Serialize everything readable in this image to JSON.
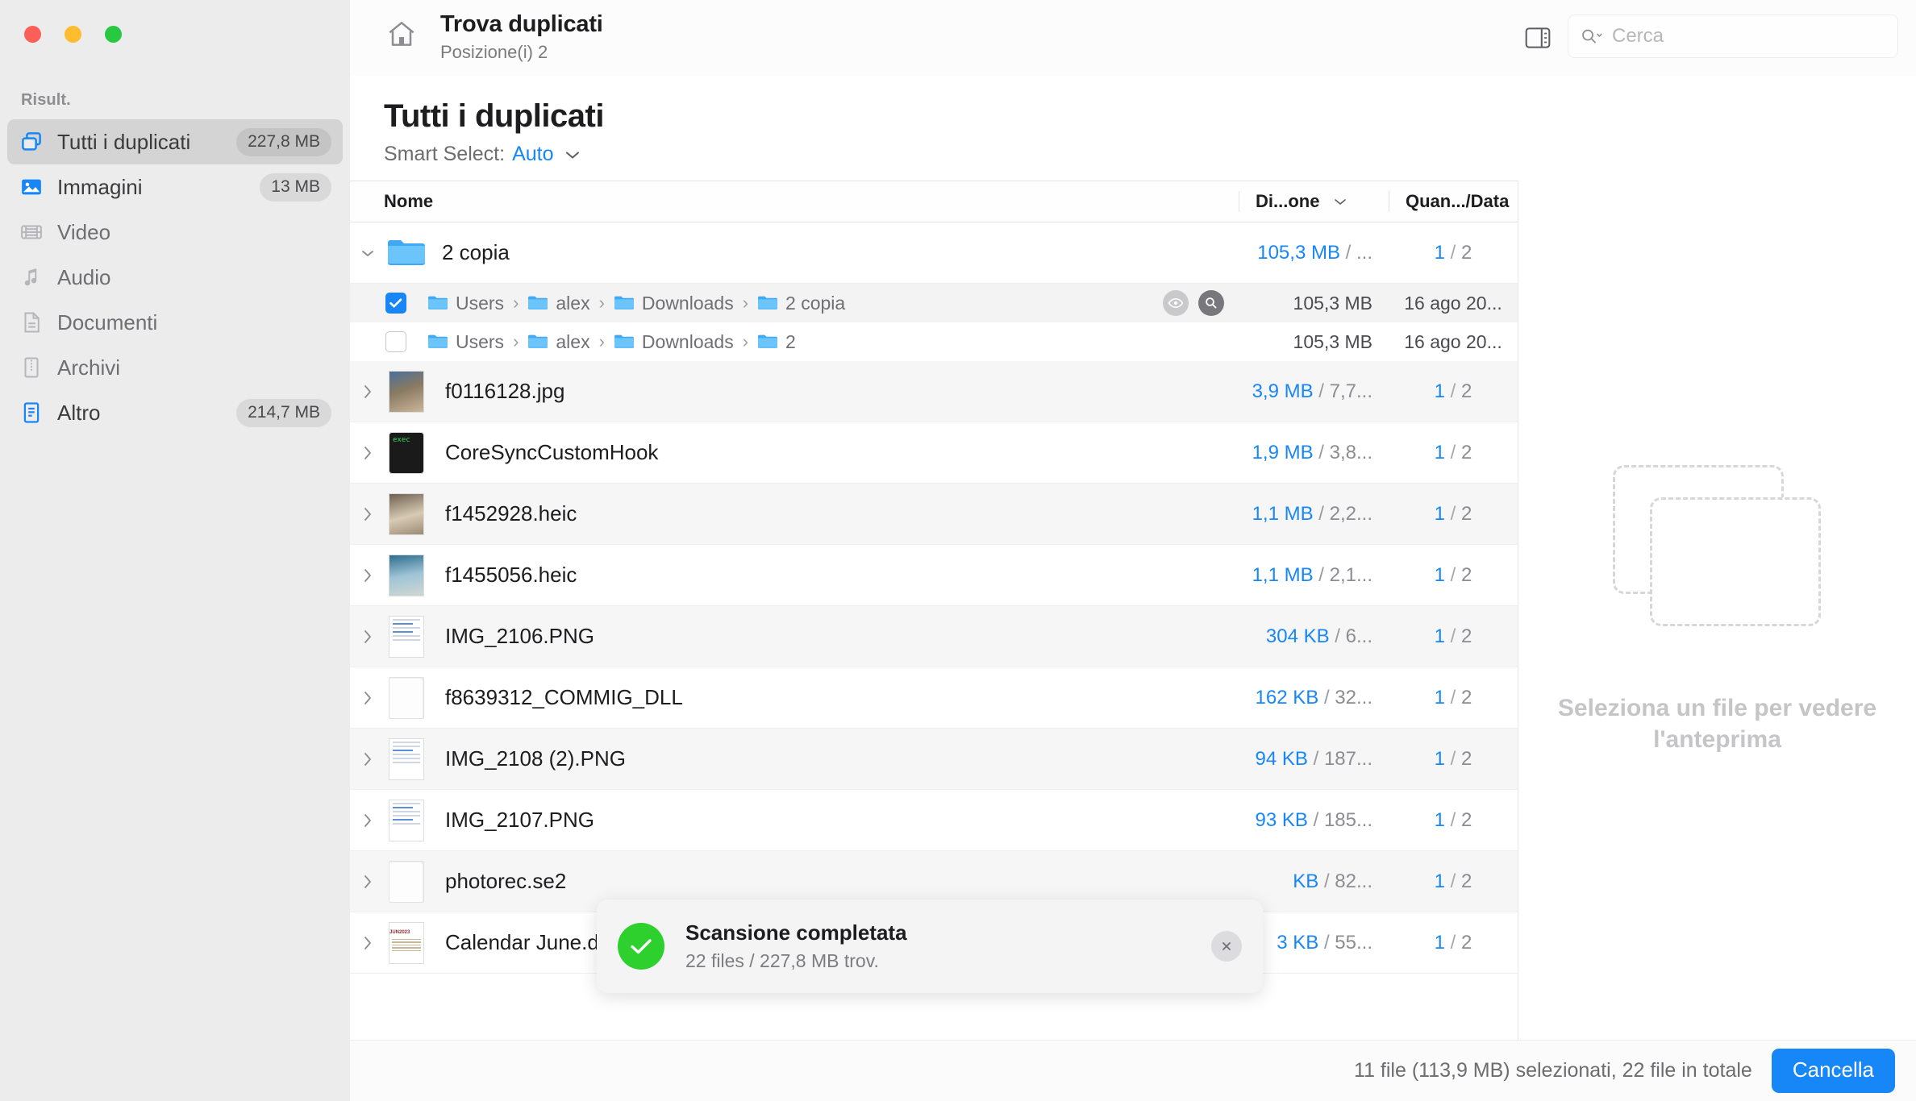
{
  "window": {
    "traffic_lights": [
      "close",
      "minimize",
      "zoom"
    ],
    "colors": {
      "accent": "#1787f8",
      "success": "#2ed02e",
      "sidebar_bg": "#ececec"
    }
  },
  "sidebar": {
    "section_title": "Risult.",
    "items": [
      {
        "label": "Tutti i duplicati",
        "badge": "227,8 MB",
        "icon": "duplicates-icon",
        "selected": true
      },
      {
        "label": "Immagini",
        "badge": "13 MB",
        "icon": "image-icon",
        "selected": false
      },
      {
        "label": "Video",
        "badge": "",
        "icon": "video-icon",
        "selected": false
      },
      {
        "label": "Audio",
        "badge": "",
        "icon": "audio-icon",
        "selected": false
      },
      {
        "label": "Documenti",
        "badge": "",
        "icon": "document-icon",
        "selected": false
      },
      {
        "label": "Archivi",
        "badge": "",
        "icon": "archive-icon",
        "selected": false
      },
      {
        "label": "Altro",
        "badge": "214,7 MB",
        "icon": "other-icon",
        "selected": false
      }
    ]
  },
  "topbar": {
    "home_icon": "home-icon",
    "title": "Trova duplicati",
    "subtitle": "Posizione(i) 2",
    "sidebar_toggle_icon": "sidebar-toggle-icon",
    "search": {
      "icon": "search-icon",
      "placeholder": "Cerca",
      "value": ""
    }
  },
  "page": {
    "title": "Tutti i duplicati",
    "smart_select_label": "Smart Select:",
    "smart_select_value": "Auto",
    "smart_select_chevron": "chevron-down-icon"
  },
  "table": {
    "columns": {
      "name": "Nome",
      "size": "Di...one",
      "size_sort_icon": "chevron-down-icon",
      "qty": "Quan.../Data"
    },
    "rows": [
      {
        "type": "group",
        "name": "2 copia",
        "thumb": "folder-icon",
        "disclosure": "chevron-down-icon",
        "size_a": "105,3 MB",
        "size_b": "...",
        "qty_a": "1",
        "qty_b": "2",
        "children": [
          {
            "checked": true,
            "crumbs": [
              "Users",
              "alex",
              "Downloads",
              "2 copia"
            ],
            "size": "105,3 MB",
            "date": "16 ago 20...",
            "hover_actions": [
              "eye-icon",
              "magnifier-icon"
            ]
          },
          {
            "checked": false,
            "crumbs": [
              "Users",
              "alex",
              "Downloads",
              "2"
            ],
            "size": "105,3 MB",
            "date": "16 ago 20...",
            "hover_actions": []
          }
        ]
      },
      {
        "type": "file",
        "name": "f0116128.jpg",
        "thumb": "image-thumb-1",
        "disclosure": "chevron-right-icon",
        "size_a": "3,9 MB",
        "size_b": "7,7...",
        "qty_a": "1",
        "qty_b": "2"
      },
      {
        "type": "file",
        "name": "CoreSyncCustomHook",
        "thumb": "exec-thumb",
        "disclosure": "chevron-right-icon",
        "size_a": "1,9 MB",
        "size_b": "3,8...",
        "qty_a": "1",
        "qty_b": "2"
      },
      {
        "type": "file",
        "name": "f1452928.heic",
        "thumb": "image-thumb-2",
        "disclosure": "chevron-right-icon",
        "size_a": "1,1 MB",
        "size_b": "2,2...",
        "qty_a": "1",
        "qty_b": "2"
      },
      {
        "type": "file",
        "name": "f1455056.heic",
        "thumb": "image-thumb-3",
        "disclosure": "chevron-right-icon",
        "size_a": "1,1 MB",
        "size_b": "2,1...",
        "qty_a": "1",
        "qty_b": "2"
      },
      {
        "type": "file",
        "name": "IMG_2106.PNG",
        "thumb": "screenshot-thumb-1",
        "disclosure": "chevron-right-icon",
        "size_a": "304 KB",
        "size_b": "6...",
        "qty_a": "1",
        "qty_b": "2"
      },
      {
        "type": "file",
        "name": "f8639312_COMMIG_DLL",
        "thumb": "blank-doc-thumb",
        "disclosure": "chevron-right-icon",
        "size_a": "162 KB",
        "size_b": "32...",
        "qty_a": "1",
        "qty_b": "2"
      },
      {
        "type": "file",
        "name": "IMG_2108 (2).PNG",
        "thumb": "screenshot-thumb-2",
        "disclosure": "chevron-right-icon",
        "size_a": "94 KB",
        "size_b": "187...",
        "qty_a": "1",
        "qty_b": "2"
      },
      {
        "type": "file",
        "name": "IMG_2107.PNG",
        "thumb": "screenshot-thumb-3",
        "disclosure": "chevron-right-icon",
        "size_a": "93 KB",
        "size_b": "185...",
        "qty_a": "1",
        "qty_b": "2"
      },
      {
        "type": "file",
        "name": "photorec.se2",
        "thumb": "blank-doc-thumb",
        "disclosure": "chevron-right-icon",
        "size_a": "KB",
        "size_b": "82...",
        "qty_a": "1",
        "qty_b": "2"
      },
      {
        "type": "file",
        "name": "Calendar June.d",
        "thumb": "calendar-thumb",
        "disclosure": "chevron-right-icon",
        "size_a": "3 KB",
        "size_b": "55...",
        "qty_a": "1",
        "qty_b": "2"
      }
    ]
  },
  "preview": {
    "placeholder_icon": "stacked-dashed-rectangles-icon",
    "placeholder_text": "Seleziona un file per vedere l'anteprima"
  },
  "toast": {
    "icon": "checkmark-circle-icon",
    "title": "Scansione completata",
    "subtitle": "22 files / 227,8 MB trov.",
    "close_icon": "close-icon"
  },
  "bottombar": {
    "status": "11 file (113,9 MB) selezionati, 22 file in totale",
    "cancel_label": "Cancella"
  }
}
